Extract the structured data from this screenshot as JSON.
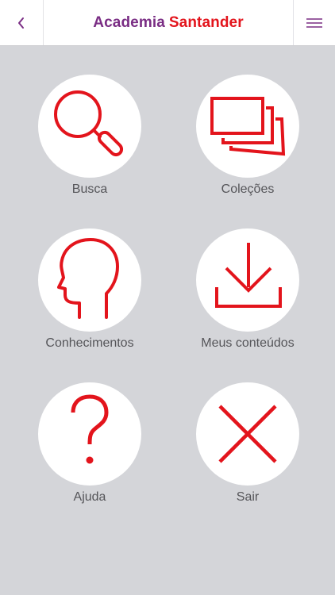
{
  "header": {
    "title_part1": "Academia",
    "title_part2": "Santander",
    "back_icon": "chevron-left-icon",
    "menu_icon": "hamburger-menu-icon"
  },
  "colors": {
    "accent": "#e3141c",
    "brand_purple": "#7a2d84",
    "background": "#d4d5d9"
  },
  "menu": {
    "busca": {
      "label": "Busca",
      "icon": "search-icon"
    },
    "colecoes": {
      "label": "Coleções",
      "icon": "collections-icon"
    },
    "conhecimentos": {
      "label": "Conhecimentos",
      "icon": "head-icon"
    },
    "meus_conteudos": {
      "label": "Meus conteúdos",
      "icon": "download-icon"
    },
    "ajuda": {
      "label": "Ajuda",
      "icon": "question-mark-icon"
    },
    "sair": {
      "label": "Sair",
      "icon": "close-icon"
    }
  }
}
